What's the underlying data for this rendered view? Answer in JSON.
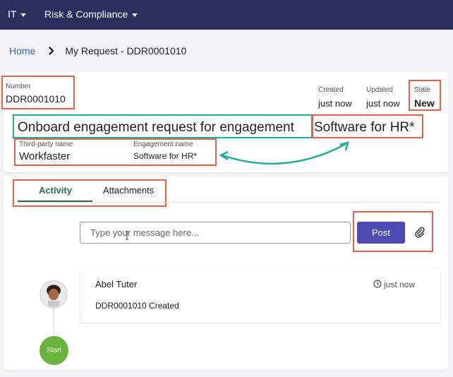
{
  "nav": {
    "menu1": "IT",
    "menu2": "Risk & Compliance"
  },
  "breadcrumb": {
    "home": "Home",
    "current": "My Request - DDR0001010"
  },
  "record": {
    "number_label": "Number",
    "number_value": "DDR0001010",
    "created_label": "Created",
    "created_value": "just now",
    "updated_label": "Updated",
    "updated_value": "just now",
    "state_label": "State",
    "state_value": "New",
    "title_prefix": "Onboard engagement request for engagement",
    "title_suffix": "Software for HR*",
    "third_party_label": "Third-party name",
    "third_party_value": "Workfaster",
    "engagement_label": "Engagement name",
    "engagement_value": "Software for HR*"
  },
  "tabs": [
    {
      "label": "Activity"
    },
    {
      "label": "Attachments"
    }
  ],
  "composer": {
    "placeholder": "Type your message here...",
    "post_label": "Post"
  },
  "feed": [
    {
      "author": "Abel Tuter",
      "time": "just now",
      "message": "DDR0001010 Created"
    }
  ],
  "timeline": {
    "start_label": "Start"
  },
  "colors": {
    "nav_bg": "#2a2f5b",
    "highlight_red": "#e0624f",
    "highlight_teal": "#23ae96",
    "post_button": "#4b4bb1",
    "active_tab": "#2a6b4a",
    "start_badge": "#6ab33d",
    "link": "#3a64b6"
  }
}
